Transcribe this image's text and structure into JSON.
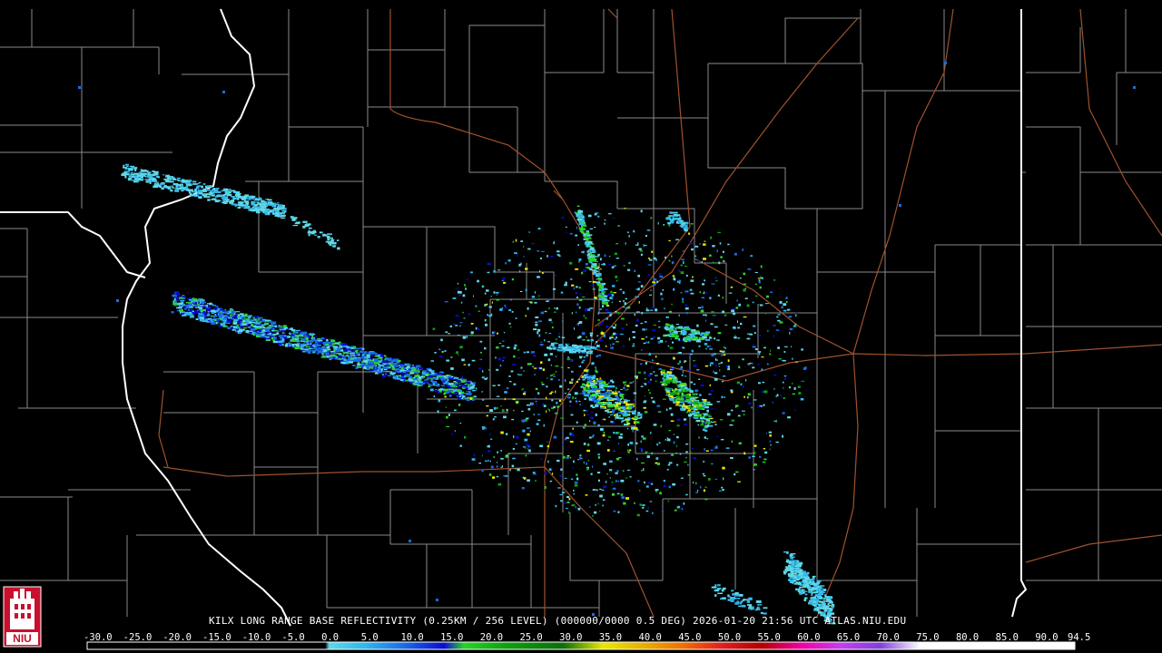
{
  "caption": "KILX LONG RANGE BASE REFLECTIVITY (0.25KM / 256 LEVEL) (000000/0000 0.5 DEG) 2026-01-20 21:56 UTC  ATLAS.NIU.EDU",
  "logo": {
    "text": "NIU",
    "color": "#c8102e"
  },
  "colorbar": {
    "ticks": [
      "-30.0",
      "-25.0",
      "-20.0",
      "-15.0",
      "-10.0",
      "-5.0",
      "0.0",
      "5.0",
      "10.0",
      "15.0",
      "20.0",
      "25.0",
      "30.0",
      "35.0",
      "40.0",
      "45.0",
      "50.0",
      "55.0",
      "60.0",
      "65.0",
      "70.0",
      "75.0",
      "80.0",
      "85.0",
      "90.0",
      "94.5"
    ],
    "stops": [
      {
        "dbz": -30,
        "color": "#000000"
      },
      {
        "dbz": 0,
        "color": "#000000"
      },
      {
        "dbz": 0.5,
        "color": "#5fd8e8"
      },
      {
        "dbz": 5,
        "color": "#31b7ec"
      },
      {
        "dbz": 10,
        "color": "#1b6be6"
      },
      {
        "dbz": 15,
        "color": "#0b0bd0"
      },
      {
        "dbz": 17.5,
        "color": "#2bd32b"
      },
      {
        "dbz": 22.5,
        "color": "#0fa30f"
      },
      {
        "dbz": 30,
        "color": "#0b6e0b"
      },
      {
        "dbz": 35,
        "color": "#e8e800"
      },
      {
        "dbz": 40,
        "color": "#e8b000"
      },
      {
        "dbz": 45,
        "color": "#f07000"
      },
      {
        "dbz": 50,
        "color": "#e02020"
      },
      {
        "dbz": 55,
        "color": "#b00000"
      },
      {
        "dbz": 60,
        "color": "#f000a0"
      },
      {
        "dbz": 65,
        "color": "#c040f0"
      },
      {
        "dbz": 70,
        "color": "#8040d8"
      },
      {
        "dbz": 75,
        "color": "#ffffff"
      },
      {
        "dbz": 94.5,
        "color": "#ffffff"
      }
    ]
  },
  "colors": {
    "county_lines": "#8a8a8a",
    "state_lines": "#ffffff",
    "highways": "#a0522d",
    "background": "#000000"
  }
}
